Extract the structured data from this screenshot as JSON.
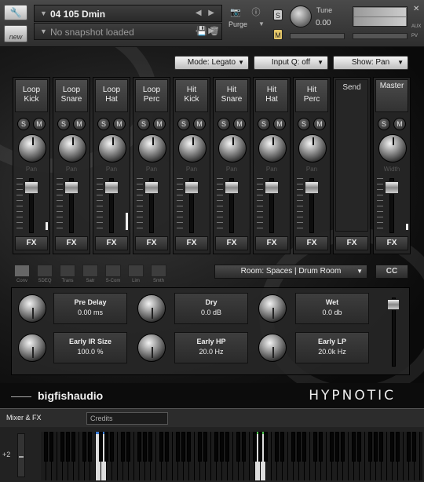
{
  "header": {
    "preset_name": "04 105 Dmin",
    "snapshot": "No snapshot loaded",
    "new_label": "new",
    "purge_label": "Purge",
    "tune_label": "Tune",
    "tune_value": "0.00",
    "solo_label": "S",
    "mute_label": "M",
    "aux_label": "AUX",
    "pv_label": "PV",
    "close_glyph": "✕"
  },
  "toolbar": {
    "mode": "Mode: Legato",
    "input_q": "Input Q: off",
    "show": "Show: Pan"
  },
  "channels": [
    {
      "line1": "Loop",
      "line2": "Kick",
      "knob_label": "Pan"
    },
    {
      "line1": "Loop",
      "line2": "Snare",
      "knob_label": "Pan"
    },
    {
      "line1": "Loop",
      "line2": "Hat",
      "knob_label": "Pan"
    },
    {
      "line1": "Loop",
      "line2": "Perc",
      "knob_label": "Pan"
    },
    {
      "line1": "Hit",
      "line2": "Kick",
      "knob_label": "Pan"
    },
    {
      "line1": "Hit",
      "line2": "Snare",
      "knob_label": "Pan"
    },
    {
      "line1": "Hit",
      "line2": "Hat",
      "knob_label": "Pan"
    },
    {
      "line1": "Hit",
      "line2": "Perc",
      "knob_label": "Pan"
    }
  ],
  "send": {
    "label": "Send"
  },
  "master": {
    "label": "Master",
    "knob_label": "Width"
  },
  "common": {
    "s": "S",
    "m": "M",
    "fx": "FX"
  },
  "fx_tabs": [
    "Conv",
    "SDEQ",
    "Trans",
    "Satr",
    "S-Com",
    "Lim",
    "Smth"
  ],
  "room": "Room: Spaces | Drum Room",
  "cc_label": "CC",
  "reverb": {
    "pre_delay": {
      "title": "Pre Delay",
      "value": "0.00 ms"
    },
    "early_ir_size": {
      "title": "Early IR Size",
      "value": "100.0 %"
    },
    "dry": {
      "title": "Dry",
      "value": "0.0 dB"
    },
    "early_hp": {
      "title": "Early HP",
      "value": "20.0 Hz"
    },
    "wet": {
      "title": "Wet",
      "value": "0.0 db"
    },
    "early_lp": {
      "title": "Early LP",
      "value": "20.0k Hz"
    }
  },
  "brand_left": "bigfishaudio",
  "brand_right": "HYPNOTIC",
  "page_tabs": {
    "active": "Mixer & FX",
    "inactive": "Credits"
  },
  "keyboard": {
    "octave": "+2"
  }
}
